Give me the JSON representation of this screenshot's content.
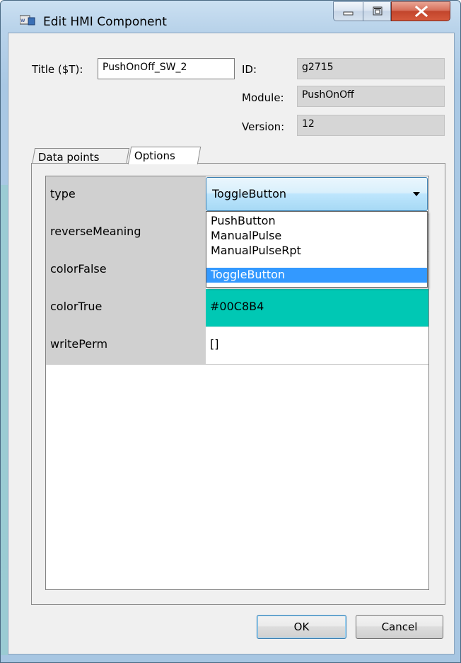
{
  "window": {
    "title": "Edit HMI Component",
    "app_icon": "hmi-app-icon"
  },
  "caption_buttons": {
    "minimize_icon": "minimize-icon",
    "maximize_icon": "maximize-icon",
    "close_icon": "close-icon"
  },
  "form": {
    "title_label": "Title ($T):",
    "title_value": "PushOnOff_SW_2",
    "id_label": "ID:",
    "id_value": "g2715",
    "module_label": "Module:",
    "module_value": "PushOnOff",
    "version_label": "Version:",
    "version_value": "12"
  },
  "tabs": [
    {
      "label": "Data points",
      "active": false
    },
    {
      "label": "Options",
      "active": true
    }
  ],
  "options": {
    "rows": [
      {
        "key": "type",
        "value": "ToggleButton"
      },
      {
        "key": "reverseMeaning",
        "value": ""
      },
      {
        "key": "colorFalse",
        "value": ""
      },
      {
        "key": "colorTrue",
        "value": "#00C8B4",
        "color": "#00c8b4"
      },
      {
        "key": "writePerm",
        "value": "[]"
      }
    ],
    "type_dropdown": {
      "selected": "ToggleButton",
      "options": [
        "PushButton",
        "ManualPulse",
        "ManualPulseRpt",
        "ToggleButton"
      ]
    }
  },
  "buttons": {
    "ok": "OK",
    "cancel": "Cancel"
  }
}
